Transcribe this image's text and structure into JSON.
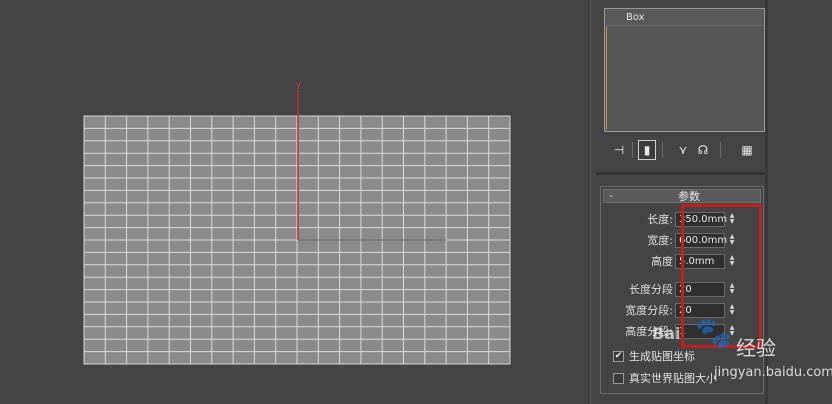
{
  "viewport": {
    "axis_label": "y",
    "grid_color": "#d9d9d9",
    "axis_color": "#c03030"
  },
  "modifier_stack": {
    "items": [
      "Box"
    ]
  },
  "toolbar": {
    "icons": [
      "pin-stack-icon",
      "show-end-result-icon",
      "make-unique-icon",
      "remove-modifier-icon",
      "configure-modifier-sets-icon"
    ]
  },
  "parameters": {
    "rollout_collapse": "-",
    "title": "参数",
    "length_label": "长度:",
    "length_value": "350.0mm",
    "width_label": "宽度:",
    "width_value": "600.0mm",
    "height_label": "高度",
    "height_value": "5.0mm",
    "length_segs_label": "长度分段",
    "length_segs_value": "20",
    "width_segs_label": "宽度分段:",
    "width_segs_value": "20",
    "height_segs_label": "高度分段:",
    "height_segs_value": "1",
    "gen_mapping_label": "生成贴图坐标",
    "gen_mapping_checked": "✔",
    "real_world_label": "真实世界贴图大小",
    "real_world_checked": ""
  },
  "annotation": {
    "highlight_color": "#c02020"
  },
  "watermark": {
    "brand": "Bai",
    "logo": "du",
    "brand2": "经验",
    "url": "jingyan.baidu.com"
  }
}
